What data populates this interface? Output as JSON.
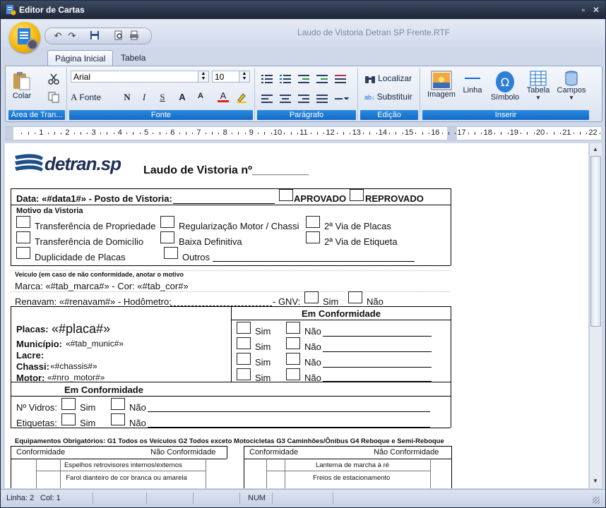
{
  "window": {
    "title": "Editor de Cartas",
    "document_title": "Laudo de Vistoria Detran SP Frente.RTF",
    "minimize_symbol": "▫",
    "close_symbol": "✕"
  },
  "tabs": [
    {
      "label": "Página Inicial",
      "active": true
    },
    {
      "label": "Tabela",
      "active": false
    }
  ],
  "ribbon": {
    "clipboard": {
      "group_label": "Área de Tran...",
      "paste_label": "Colar"
    },
    "font": {
      "group_label": "Fonte",
      "font_name": "Arial",
      "font_size": "10",
      "font_dialog_label": "Fonte",
      "bold": "N",
      "italic": "I",
      "strike": "S",
      "grow": "A",
      "shrink": "A",
      "color": "A"
    },
    "paragraph": {
      "group_label": "Parágrafo"
    },
    "edit": {
      "group_label": "Edição",
      "find_label": "Localizar",
      "replace_label": "Substituir"
    },
    "insert": {
      "group_label": "Inserir",
      "image_label": "Imagem",
      "line_label": "Linha",
      "symbol_label": "Símbolo",
      "table_label": "Tabela",
      "fields_label": "Campos"
    }
  },
  "ruler": {
    "numbers": [
      "1",
      "2",
      "3",
      "4",
      "5",
      "6",
      "7",
      "8",
      "9",
      "10",
      "11",
      "12",
      "13",
      "14",
      "15",
      "16",
      "17",
      "18",
      "19",
      "20",
      "21",
      "22"
    ]
  },
  "doc": {
    "logo_text": "detran.sp",
    "heading": "Laudo de Vistoria nº_________",
    "data_line": "Data: «#data1#» - Posto de Vistoria:",
    "aprovado": "APROVADO",
    "reprovado": "REPROVADO",
    "motivo_title": "Motivo da Vistoria",
    "motivos": [
      "Transferência de Propriedade",
      "Regularização Motor / Chassi",
      "2ª Via de Placas",
      "Transferência de Domicílio",
      "Baixa Definitiva",
      "2ª Via de Etiqueta",
      "Duplicidade de Placas",
      "Outros"
    ],
    "veiculo_note": "Veículo (em caso de não conformidade, anotar o motivo",
    "marca_line": "Marca: «#tab_marca#» - Cor: «#tab_cor#»",
    "renavam_line": "Renavam: «#renavam#» - Hodômetro:",
    "gnv_label": "- GNV:",
    "sim": "Sim",
    "nao": "Não",
    "em_conformidade": "Em Conformidade",
    "placas_label": "Placas:",
    "placas_value": "«#placa#»",
    "municipio_label": "Município:",
    "municipio_value": "«#tab_munic#»",
    "lacre_label": "Lacre:",
    "chassi_label": "Chassi:",
    "chassi_value": "«#chassis#»",
    "motor_label": "Motor:",
    "motor_value": "«#nro_motor#»",
    "vidros_label": "Nº Vidros:",
    "etiquetas_label": "Etiquetas:",
    "equip_title": "Equipamentos Obrigatórios: G1 Todos os Veículos G2 Todos exceto Motocicletas G3 Caminhões/Ônibus G4 Reboque e Semi-Reboque",
    "conformidade": "Conformidade",
    "nao_conformidade": "Não Conformidade",
    "left_items": [
      "Espelhos retrovisores internos/externos",
      "Farol dianteiro de cor branca ou amarela"
    ],
    "right_items": [
      "Lanterna de marcha à ré",
      "Freios de estacionamento"
    ]
  },
  "status": {
    "line": "Linha: 2",
    "col": "Col: 1",
    "num": "NUM"
  }
}
